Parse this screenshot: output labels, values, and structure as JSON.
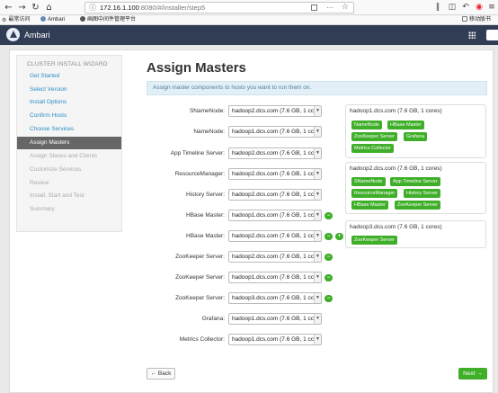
{
  "browser": {
    "url_host": "172.16.1.100",
    "url_rest": ":8080/#/installer/step5",
    "more_label": "···",
    "bookmarks": [
      {
        "label": "最常访问"
      },
      {
        "label": "Ambari"
      },
      {
        "label": "画图中间件管理平台"
      },
      {
        "label": "移动版书"
      }
    ]
  },
  "app": {
    "name": "Ambari"
  },
  "sidebar": {
    "title": "CLUSTER INSTALL WIZARD",
    "items": [
      {
        "label": "Get Started",
        "state": "done"
      },
      {
        "label": "Select Version",
        "state": "done"
      },
      {
        "label": "Install Options",
        "state": "done"
      },
      {
        "label": "Confirm Hosts",
        "state": "done"
      },
      {
        "label": "Choose Services",
        "state": "done"
      },
      {
        "label": "Assign Masters",
        "state": "active"
      },
      {
        "label": "Assign Slaves and Clients",
        "state": "todo"
      },
      {
        "label": "Customize Services",
        "state": "todo"
      },
      {
        "label": "Review",
        "state": "todo"
      },
      {
        "label": "Install, Start and Test",
        "state": "todo"
      },
      {
        "label": "Summary",
        "state": "todo"
      }
    ]
  },
  "main": {
    "title": "Assign Masters",
    "alert": "Assign master components to hosts you want to run them on.",
    "assignments": [
      {
        "label": "SNameNode:",
        "value": "hadoop2.dcs.com (7.6 GB, 1 cc",
        "controls": ""
      },
      {
        "label": "NameNode:",
        "value": "hadoop1.dcs.com (7.6 GB, 1 cc",
        "controls": ""
      },
      {
        "label": "App Timeline Server:",
        "value": "hadoop2.dcs.com (7.6 GB, 1 cc",
        "controls": ""
      },
      {
        "label": "ResourceManager:",
        "value": "hadoop2.dcs.com (7.6 GB, 1 cc",
        "controls": ""
      },
      {
        "label": "History Server:",
        "value": "hadoop2.dcs.com (7.6 GB, 1 cc",
        "controls": ""
      },
      {
        "label": "HBase Master:",
        "value": "hadoop1.dcs.com (7.6 GB, 1 cc",
        "controls": "-"
      },
      {
        "label": "HBase Master:",
        "value": "hadoop2.dcs.com (7.6 GB, 1 cc",
        "controls": "-+"
      },
      {
        "label": "ZooKeeper Server:",
        "value": "hadoop2.dcs.com (7.6 GB, 1 cc",
        "controls": "-"
      },
      {
        "label": "ZooKeeper Server:",
        "value": "hadoop1.dcs.com (7.6 GB, 1 cc",
        "controls": "-"
      },
      {
        "label": "ZooKeeper Server:",
        "value": "hadoop3.dcs.com (7.6 GB, 1 cc",
        "controls": "-"
      },
      {
        "label": "Grafana:",
        "value": "hadoop1.dcs.com (7.6 GB, 1 cc",
        "controls": ""
      },
      {
        "label": "Metrics Collector:",
        "value": "hadoop1.dcs.com (7.6 GB, 1 cc",
        "controls": ""
      }
    ],
    "hosts": [
      {
        "title": "hadoop1.dcs.com (7.6 GB, 1 cores)",
        "components": [
          "NameNode",
          "HBase Master",
          "ZooKeeper Server",
          "Grafana",
          "Metrics Collector"
        ]
      },
      {
        "title": "hadoop2.dcs.com (7.6 GB, 1 cores)",
        "components": [
          "SNameNode",
          "App Timeline Server",
          "ResourceManager",
          "History Server",
          "HBase Master",
          "ZooKeeper Server"
        ]
      },
      {
        "title": "hadoop3.dcs.com (7.6 GB, 1 cores)",
        "components": [
          "ZooKeeper Server"
        ]
      }
    ],
    "back_label": "← Back",
    "next_label": "Next →"
  },
  "colors": {
    "brand": "#313d54",
    "accent": "#3fae29",
    "link": "#2b8cc4"
  }
}
